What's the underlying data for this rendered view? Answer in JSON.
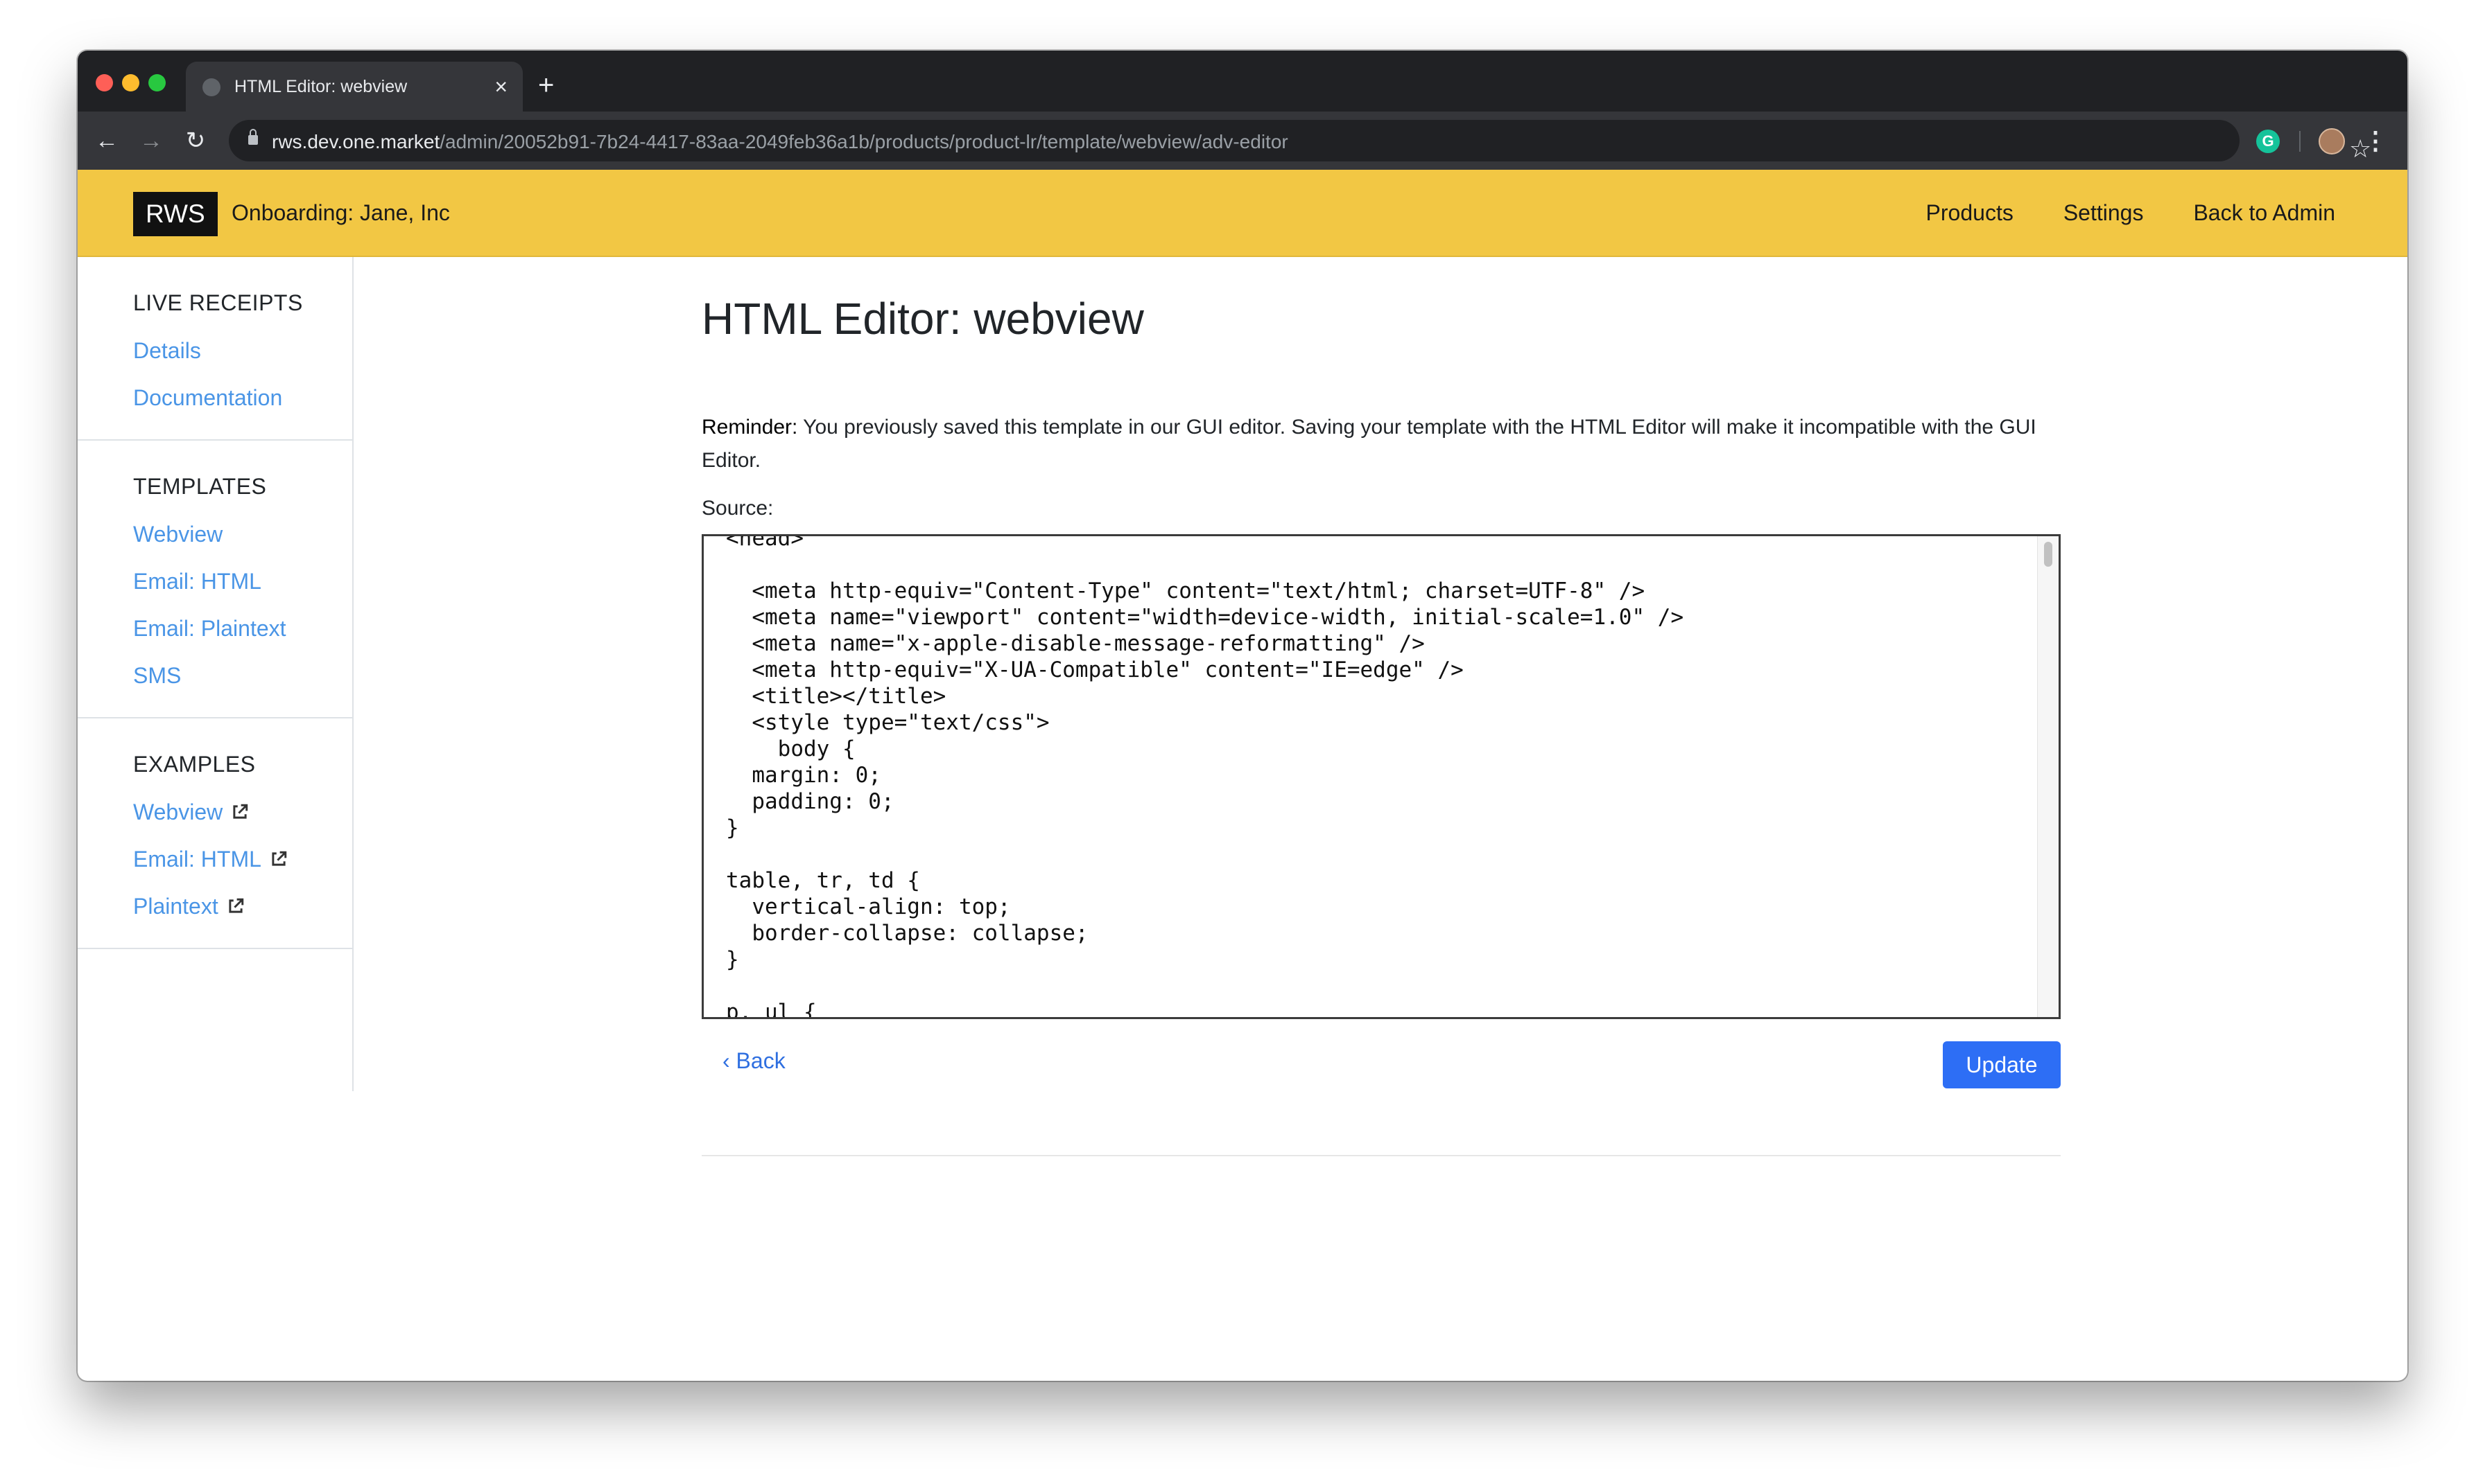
{
  "browser": {
    "tab_title": "HTML Editor: webview",
    "tab_close": "×",
    "new_tab": "+",
    "url_host": "rws.dev.one.market",
    "url_path": "/admin/20052b91-7b24-4417-83aa-2049feb36a1b/products/product-lr/template/webview/adv-editor",
    "extension_letter": "G",
    "back_glyph": "←",
    "forward_glyph": "→",
    "reload_glyph": "↻",
    "star_glyph": "☆",
    "menu_glyph": "⋮"
  },
  "header": {
    "brand": "RWS",
    "onboarding": "Onboarding: Jane, Inc",
    "nav": [
      "Products",
      "Settings",
      "Back to Admin"
    ]
  },
  "sidebar": {
    "sections": [
      {
        "heading": "LIVE RECEIPTS",
        "items": [
          "Details",
          "Documentation"
        ]
      },
      {
        "heading": "TEMPLATES",
        "items": [
          "Webview",
          "Email: HTML",
          "Email: Plaintext",
          "SMS"
        ]
      },
      {
        "heading": "EXAMPLES",
        "items": [
          "Webview",
          "Email: HTML",
          "Plaintext"
        ]
      }
    ]
  },
  "main": {
    "title": "HTML Editor: webview",
    "reminder_label": "Reminder:",
    "reminder_text": " You previously saved this template in our GUI editor. Saving your template with the HTML Editor will make it incompatible with the GUI Editor.",
    "source_label": "Source:",
    "source_code": "<head>\n\n  <meta http-equiv=\"Content-Type\" content=\"text/html; charset=UTF-8\" />\n  <meta name=\"viewport\" content=\"width=device-width, initial-scale=1.0\" />\n  <meta name=\"x-apple-disable-message-reformatting\" />\n  <meta http-equiv=\"X-UA-Compatible\" content=\"IE=edge\" />\n  <title></title>\n  <style type=\"text/css\">\n    body {\n  margin: 0;\n  padding: 0;\n}\n\ntable, tr, td {\n  vertical-align: top;\n  border-collapse: collapse;\n}\n\np, ul {",
    "back_label": "‹ Back",
    "update_label": "Update"
  }
}
